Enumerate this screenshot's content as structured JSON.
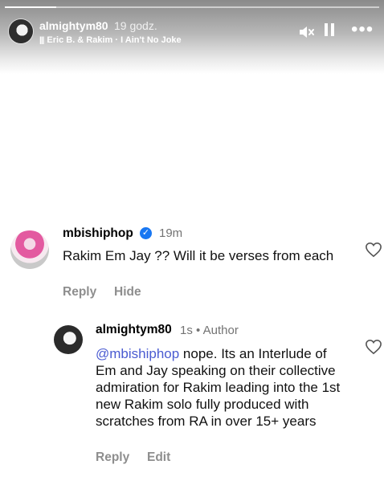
{
  "story": {
    "username": "almightym80",
    "time": "19 godz.",
    "music_icon": "music-bars-icon",
    "music": "Eric B. & Rakim · I Ain't No Joke",
    "controls": [
      "mute-icon",
      "pause-icon",
      "more-icon"
    ]
  },
  "comments": [
    {
      "username": "mbiships hop",
      "verified": true,
      "time": "19m",
      "text": "Rakim Em Jay ?? Will it be verses from each",
      "actions": [
        "Reply",
        "Hide"
      ]
    },
    {
      "username": "almightym80",
      "time": "1s",
      "separator": "•",
      "author_badge": "Author",
      "mention": "@mbishiphop",
      "text": " nope. Its an Interlude of Em and Jay speaking on their collective admiration for Rakim leading into the 1st new Rakim solo fully produced with scratches from RA in over 15+ years",
      "actions": [
        "Reply",
        "Edit"
      ]
    }
  ],
  "colors": {
    "verified": "#1877f2",
    "mention": "#4a5bd1",
    "muted_text": "#737373"
  }
}
